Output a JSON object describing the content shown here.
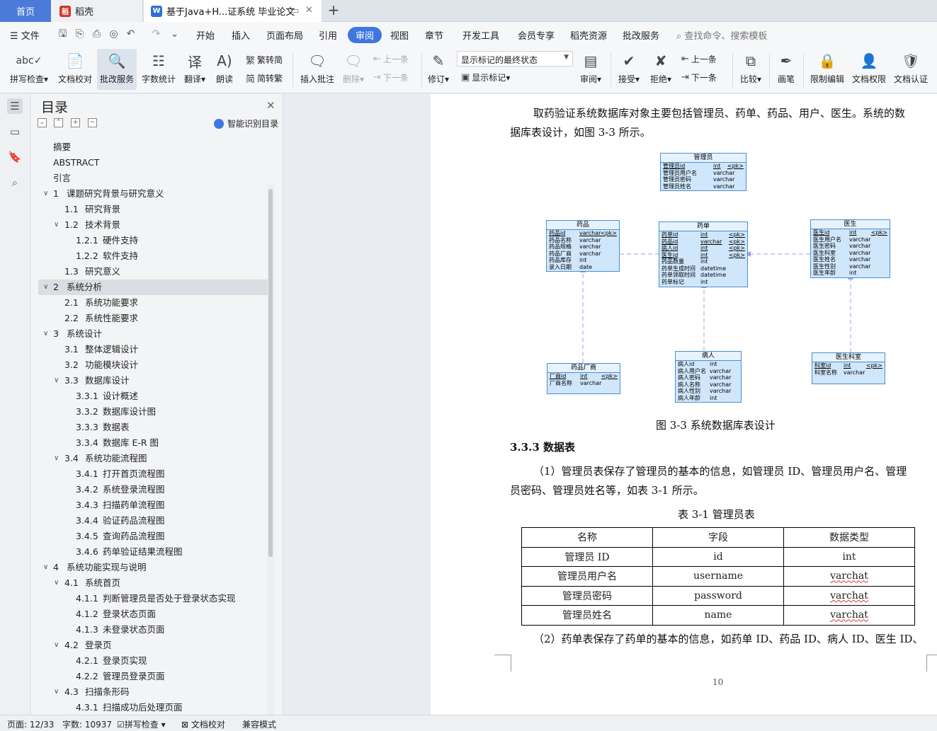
{
  "tabs": {
    "home": "首页",
    "daoke": "稻壳",
    "doc": "基于Java+H...证系统 毕业论文",
    "new_tab": "+"
  },
  "menubar": {
    "file": "文件",
    "items": [
      "开始",
      "插入",
      "页面布局",
      "引用",
      "审阅",
      "视图",
      "章节",
      "开发工具",
      "会员专享",
      "稻壳资源",
      "批改服务"
    ],
    "active": "审阅",
    "search": "查找命令、搜索模板"
  },
  "ribbon": {
    "spell": "拼写检查",
    "proof": "文档校对",
    "review_service": "批改服务",
    "word_count": "字数统计",
    "translate": "翻译",
    "read_aloud": "朗读",
    "to_traditional": "繁转简",
    "to_simplified": "简转繁",
    "insert_comment": "插入批注",
    "delete": "删除",
    "prev": "上一条",
    "next": "下一条",
    "revise": "修订",
    "markup_state": "显示标记的最终状态",
    "show_markup": "显示标记",
    "review": "审阅",
    "accept": "接受",
    "reject": "拒绝",
    "prev2": "上一条",
    "next2": "下一条",
    "compare": "比较",
    "pen": "画笔",
    "restrict": "限制编辑",
    "permission": "文档权限",
    "certify": "文档认证"
  },
  "toc": {
    "title": "目录",
    "smart": "智能识别目录",
    "items": [
      {
        "level": 0,
        "num": "",
        "title": "摘要"
      },
      {
        "level": 0,
        "num": "",
        "title": "ABSTRACT"
      },
      {
        "level": 0,
        "num": "",
        "title": "引言"
      },
      {
        "level": 1,
        "num": "1",
        "title": "课题研究背景与研究意义",
        "arrow": true
      },
      {
        "level": 2,
        "num": "1.1",
        "title": "研究背景"
      },
      {
        "level": 2,
        "num": "1.2",
        "title": "技术背景",
        "arrow": true
      },
      {
        "level": 3,
        "num": "1.2.1",
        "title": "硬件支持"
      },
      {
        "level": 3,
        "num": "1.2.2",
        "title": "软件支持"
      },
      {
        "level": 2,
        "num": "1.3",
        "title": "研究意义"
      },
      {
        "level": 1,
        "num": "2",
        "title": "系统分析",
        "arrow": true,
        "selected": true
      },
      {
        "level": 2,
        "num": "2.1",
        "title": "系统功能要求"
      },
      {
        "level": 2,
        "num": "2.2",
        "title": "系统性能要求"
      },
      {
        "level": 1,
        "num": "3",
        "title": "系统设计",
        "arrow": true
      },
      {
        "level": 2,
        "num": "3.1",
        "title": "整体逻辑设计"
      },
      {
        "level": 2,
        "num": "3.2",
        "title": "功能模块设计"
      },
      {
        "level": 2,
        "num": "3.3",
        "title": "数据库设计",
        "arrow": true
      },
      {
        "level": 3,
        "num": "3.3.1",
        "title": "设计概述"
      },
      {
        "level": 3,
        "num": "3.3.2",
        "title": "数据库设计图"
      },
      {
        "level": 3,
        "num": "3.3.3",
        "title": "数据表"
      },
      {
        "level": 3,
        "num": "3.3.4",
        "title": "数据库 E-R 图"
      },
      {
        "level": 2,
        "num": "3.4",
        "title": "系统功能流程图",
        "arrow": true
      },
      {
        "level": 3,
        "num": "3.4.1",
        "title": "打开首页流程图"
      },
      {
        "level": 3,
        "num": "3.4.2",
        "title": "系统登录流程图"
      },
      {
        "level": 3,
        "num": "3.4.3",
        "title": "扫描药单流程图"
      },
      {
        "level": 3,
        "num": "3.4.4",
        "title": "验证药品流程图"
      },
      {
        "level": 3,
        "num": "3.4.5",
        "title": "查询药品流程图"
      },
      {
        "level": 3,
        "num": "3.4.6",
        "title": "药单验证结果流程图"
      },
      {
        "level": 1,
        "num": "4",
        "title": "系统功能实现与说明",
        "arrow": true
      },
      {
        "level": 2,
        "num": "4.1",
        "title": "系统首页",
        "arrow": true
      },
      {
        "level": 3,
        "num": "4.1.1",
        "title": "判断管理员是否处于登录状态实现"
      },
      {
        "level": 3,
        "num": "4.1.2",
        "title": "登录状态页面"
      },
      {
        "level": 3,
        "num": "4.1.3",
        "title": "未登录状态页面"
      },
      {
        "level": 2,
        "num": "4.2",
        "title": "登录页",
        "arrow": true
      },
      {
        "level": 3,
        "num": "4.2.1",
        "title": "登录页实现"
      },
      {
        "level": 3,
        "num": "4.2.2",
        "title": "管理员登录页面"
      },
      {
        "level": 2,
        "num": "4.3",
        "title": "扫描条形码",
        "arrow": true
      },
      {
        "level": 3,
        "num": "4.3.1",
        "title": "扫描成功后处理页面"
      }
    ]
  },
  "document": {
    "para1_line1": "取药验证系统数据库对象主要包括管理员、药单、药品、用户、医生。系统的数",
    "para1_line2": "据库表设计，如图 3-3 所示。",
    "figure_caption": "图 3-3  系统数据库表设计",
    "section": "3.3.3    数据表",
    "para2_line1": "（1）管理员表保存了管理员的基本的信息，如管理员 ID、管理员用户名、管理",
    "para2_line2": "员密码、管理员姓名等，如表 3-1 所示。",
    "table_caption": "表 3-1  管理员表",
    "table": {
      "headers": [
        "名称",
        "字段",
        "数据类型"
      ],
      "rows": [
        [
          "管理员 ID",
          "id",
          "int"
        ],
        [
          "管理员用户名",
          "username",
          "varchat"
        ],
        [
          "管理员密码",
          "password",
          "varchat"
        ],
        [
          "管理员姓名",
          "name",
          "varchat"
        ]
      ]
    },
    "para3": "（2）药单表保存了药单的基本的信息，如药单 ID、药品 ID、病人 ID、医生 ID、",
    "page_number": "10"
  },
  "er": {
    "admin": {
      "title": "管理员",
      "rows": [
        [
          "管理员id",
          "int",
          "<pk>"
        ],
        [
          "管理员用户名",
          "varchar",
          ""
        ],
        [
          "管理员密码",
          "varchar",
          ""
        ],
        [
          "管理员姓名",
          "varchar",
          ""
        ]
      ]
    },
    "drug": {
      "title": "药品",
      "rows": [
        [
          "药品id",
          "varchar",
          "<pk>"
        ],
        [
          "药品名称",
          "varchar",
          ""
        ],
        [
          "药品规格",
          "varchar",
          ""
        ],
        [
          "药品厂商",
          "varchar",
          ""
        ],
        [
          "药品库存",
          "int",
          ""
        ],
        [
          "录入日期",
          "date",
          ""
        ]
      ]
    },
    "order": {
      "title": "药单",
      "rows": [
        [
          "药单id",
          "int",
          "<pk>"
        ],
        [
          "药品id",
          "varchar",
          "<pk>"
        ],
        [
          "病人id",
          "int",
          "<pk>"
        ],
        [
          "医生id",
          "int",
          "<pk>"
        ],
        [
          "药品数量",
          "int",
          ""
        ],
        [
          "药单生成时间",
          "datetime",
          ""
        ],
        [
          "药单领取时间",
          "datetime",
          ""
        ],
        [
          "药单标记",
          "int",
          ""
        ]
      ]
    },
    "doctor": {
      "title": "医生",
      "rows": [
        [
          "医生id",
          "int",
          "<pk>"
        ],
        [
          "医生用户名",
          "varchar",
          ""
        ],
        [
          "医生密码",
          "varchar",
          ""
        ],
        [
          "医生科室",
          "varchar",
          ""
        ],
        [
          "医生姓名",
          "varchar",
          ""
        ],
        [
          "医生性别",
          "varchar",
          ""
        ],
        [
          "医生年龄",
          "int",
          ""
        ]
      ]
    },
    "maker": {
      "title": "药品厂商",
      "rows": [
        [
          "厂商id",
          "int",
          "<pk>"
        ],
        [
          "厂商名称",
          "varchar",
          ""
        ]
      ]
    },
    "patient": {
      "title": "病人",
      "rows": [
        [
          "病人id",
          "int",
          ""
        ],
        [
          "病人用户名",
          "varchar",
          ""
        ],
        [
          "病人密码",
          "varchar",
          ""
        ],
        [
          "病人名称",
          "varchar",
          ""
        ],
        [
          "病人性别",
          "varchar",
          ""
        ],
        [
          "病人年龄",
          "int",
          ""
        ]
      ]
    },
    "dept": {
      "title": "医生科室",
      "rows": [
        [
          "科室id",
          "int",
          "<pk>"
        ],
        [
          "科室名称",
          "varchar",
          ""
        ]
      ]
    }
  },
  "status": {
    "page": "页面: 12/33",
    "words": "字数: 10937",
    "spell": "拼写检查",
    "proof": "文档校对",
    "compat": "兼容模式"
  }
}
